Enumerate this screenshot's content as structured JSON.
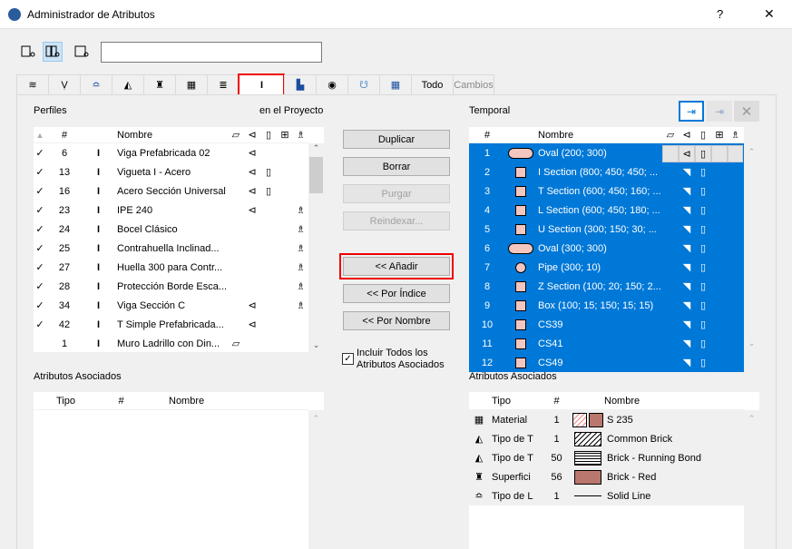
{
  "window": {
    "title": "Administrador de Atributos",
    "help": "?",
    "close": "✕"
  },
  "tabs": {
    "todo": "Todo",
    "cambios": "Cambios",
    "active": "profiles"
  },
  "search": {
    "value": ""
  },
  "left": {
    "title": "Perfiles",
    "subtitle": "en el Proyecto",
    "headers": {
      "num": "#",
      "name": "Nombre"
    },
    "rows": [
      {
        "check": "✓",
        "num": "6",
        "name": "Viga Prefabricada 02",
        "uses": [
          "beam"
        ]
      },
      {
        "check": "✓",
        "num": "13",
        "name": "Vigueta I - Acero",
        "uses": [
          "beam",
          "column"
        ]
      },
      {
        "check": "✓",
        "num": "16",
        "name": "Acero Sección Universal",
        "uses": [
          "beam",
          "column"
        ]
      },
      {
        "check": "✓",
        "num": "23",
        "name": "IPE 240",
        "uses": [
          "beam",
          "object"
        ]
      },
      {
        "check": "✓",
        "num": "24",
        "name": "Bocel Clásico",
        "uses": [
          "object"
        ]
      },
      {
        "check": "✓",
        "num": "25",
        "name": "Contrahuella Inclinad...",
        "uses": [
          "object"
        ]
      },
      {
        "check": "✓",
        "num": "27",
        "name": "Huella 300 para Contr...",
        "uses": [
          "object"
        ]
      },
      {
        "check": "✓",
        "num": "28",
        "name": "Protección Borde Esca...",
        "uses": [
          "object"
        ]
      },
      {
        "check": "✓",
        "num": "34",
        "name": "Viga Sección C",
        "uses": [
          "beam",
          "object"
        ]
      },
      {
        "check": "✓",
        "num": "42",
        "name": "T Simple Prefabricada...",
        "uses": [
          "beam"
        ]
      },
      {
        "check": "",
        "num": "1",
        "name": "Muro Ladrillo con Din...",
        "uses": [
          "wall"
        ]
      }
    ]
  },
  "buttons": {
    "duplicar": "Duplicar",
    "borrar": "Borrar",
    "purgar": "Purgar",
    "reindexar": "Reindexar...",
    "anadir": "<< Añadir",
    "por_indice": "<< Por Índice",
    "por_nombre": "<< Por Nombre",
    "incluir": "Incluir Todos los Atributos Asociados",
    "incluir_checked": true
  },
  "right": {
    "title": "Temporal",
    "headers": {
      "num": "#",
      "name": "Nombre"
    },
    "rows": [
      {
        "num": "1",
        "name": "Oval (200; 300)"
      },
      {
        "num": "2",
        "name": "I Section (800; 450; 450; ..."
      },
      {
        "num": "3",
        "name": "T Section (600; 450; 160; ..."
      },
      {
        "num": "4",
        "name": "L Section (600; 450; 180; ..."
      },
      {
        "num": "5",
        "name": "U Section (300; 150; 30; ..."
      },
      {
        "num": "6",
        "name": "Oval (300; 300)"
      },
      {
        "num": "7",
        "name": "Pipe (300; 10)"
      },
      {
        "num": "8",
        "name": "Z Section (100; 20; 150; 2..."
      },
      {
        "num": "9",
        "name": "Box (100; 15; 150; 15; 15)"
      },
      {
        "num": "10",
        "name": "CS39"
      },
      {
        "num": "11",
        "name": "CS41"
      },
      {
        "num": "12",
        "name": "CS49"
      }
    ]
  },
  "assoc_left": {
    "title": "Atributos Asociados",
    "headers": {
      "tipo": "Tipo",
      "num": "#",
      "name": "Nombre"
    }
  },
  "assoc_right": {
    "title": "Atributos Asociados",
    "headers": {
      "tipo": "Tipo",
      "num": "#",
      "name": "Nombre"
    },
    "rows": [
      {
        "icon": "material-icon",
        "tipo": "Material",
        "num": "1",
        "name": "S 235",
        "swatch": "#b9776d"
      },
      {
        "icon": "fill-icon",
        "tipo": "Tipo de T",
        "num": "1",
        "name": "Common Brick",
        "swatch": "hatch"
      },
      {
        "icon": "fill-icon",
        "tipo": "Tipo de T",
        "num": "50",
        "name": "Brick - Running Bond",
        "swatch": "brick"
      },
      {
        "icon": "surface-icon",
        "tipo": "Superfici",
        "num": "56",
        "name": "Brick - Red",
        "swatch": "#b9776d"
      },
      {
        "icon": "line-icon",
        "tipo": "Tipo de L",
        "num": "1",
        "name": "Solid Line",
        "swatch": "line"
      }
    ]
  },
  "colors": {
    "selection": "#0078d7",
    "highlight": "#e00000",
    "surface": "#b9776d"
  }
}
